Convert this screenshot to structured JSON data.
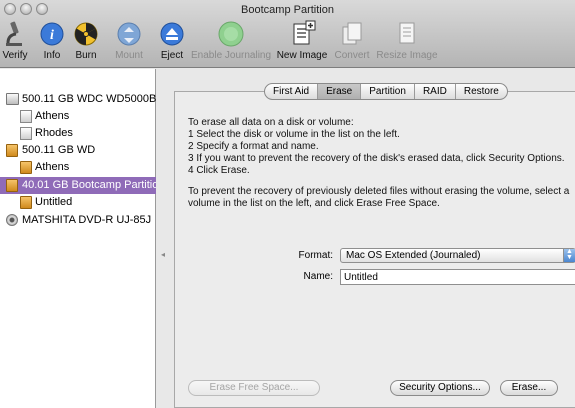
{
  "window": {
    "title": "Bootcamp Partition"
  },
  "toolbar": {
    "items": [
      {
        "label": "Verify",
        "icon": "microscope-icon",
        "enabled": true
      },
      {
        "label": "Info",
        "icon": "info-icon",
        "enabled": true
      },
      {
        "label": "Burn",
        "icon": "burn-icon",
        "enabled": true
      },
      {
        "label": "Mount",
        "icon": "mount-icon",
        "enabled": true
      },
      {
        "label": "Eject",
        "icon": "eject-icon",
        "enabled": true
      },
      {
        "label": "Enable Journaling",
        "icon": "journaling-icon",
        "enabled": false
      },
      {
        "label": "New Image",
        "icon": "new-image-icon",
        "enabled": true
      },
      {
        "label": "Convert",
        "icon": "convert-icon",
        "enabled": false
      },
      {
        "label": "Resize Image",
        "icon": "resize-image-icon",
        "enabled": false
      }
    ]
  },
  "sidebar": {
    "items": [
      {
        "label": "500.11 GB WDC WD5000B...",
        "type": "disk",
        "selected": false
      },
      {
        "label": "Athens",
        "type": "volume",
        "selected": false
      },
      {
        "label": "Rhodes",
        "type": "volume",
        "selected": false
      },
      {
        "label": "500.11 GB WD",
        "type": "firewire-disk",
        "selected": false
      },
      {
        "label": "Athens",
        "type": "firewire-volume",
        "selected": false
      },
      {
        "label": "40.01 GB Bootcamp Partitio...",
        "type": "firewire-volume",
        "selected": true
      },
      {
        "label": "Untitled",
        "type": "firewire-volume",
        "selected": false
      },
      {
        "label": "MATSHITA DVD-R UJ-85J",
        "type": "dvd",
        "selected": false
      }
    ]
  },
  "tabs": [
    {
      "label": "First Aid",
      "active": false
    },
    {
      "label": "Erase",
      "active": true
    },
    {
      "label": "Partition",
      "active": false
    },
    {
      "label": "RAID",
      "active": false
    },
    {
      "label": "Restore",
      "active": false
    }
  ],
  "erase": {
    "instructions": [
      "To erase all data on a disk or volume:",
      "1 Select the disk or volume in the list on the left.",
      "2 Specify a format and name.",
      "3 If you want to prevent the recovery of the disk's erased data, click Security Options.",
      "4 Click Erase.",
      "To prevent the recovery of previously deleted files without erasing the volume, select a",
      "volume in the list on the left, and click Erase Free Space."
    ],
    "format_label": "Format:",
    "format_value": "Mac OS Extended (Journaled)",
    "name_label": "Name:",
    "name_value": "Untitled",
    "erase_free_space_button": "Erase Free Space...",
    "security_options_button": "Security Options...",
    "erase_button": "Erase..."
  },
  "colors": {
    "selection": "#8f6bb8",
    "toolbar_bg": "#c8c8c8"
  }
}
